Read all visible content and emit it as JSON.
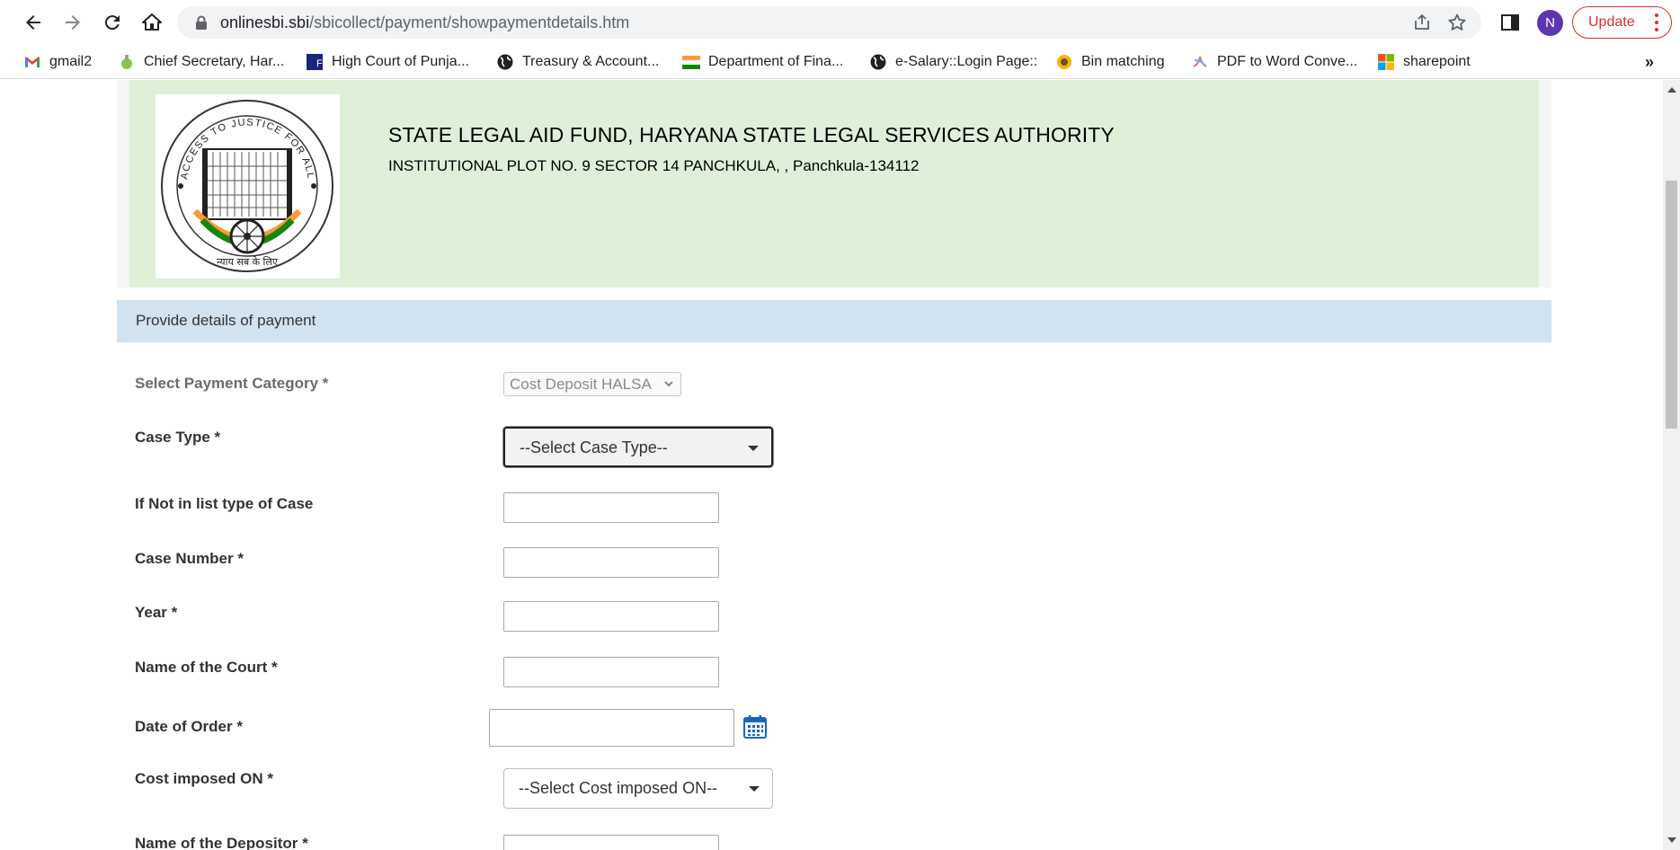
{
  "browser": {
    "url_host": "onlinesbi.sbi",
    "url_path": "/sbicollect/payment/showpaymentdetails.htm",
    "profile_initial": "N",
    "update_label": "Update",
    "bookmarks": [
      {
        "label": "gmail2",
        "icon": "gmail-icon"
      },
      {
        "label": "Chief Secretary, Har...",
        "icon": "emblem-icon"
      },
      {
        "label": "High Court of Punja...",
        "icon": "hc-icon"
      },
      {
        "label": "Treasury & Account...",
        "icon": "globe-icon"
      },
      {
        "label": "Department of Fina...",
        "icon": "flag-icon"
      },
      {
        "label": "e-Salary::Login Page::",
        "icon": "globe-icon"
      },
      {
        "label": "Bin matching",
        "icon": "bin-icon"
      },
      {
        "label": "PDF to Word Conve...",
        "icon": "pdf-icon"
      },
      {
        "label": "sharepoint",
        "icon": "ms-icon"
      }
    ],
    "more_label": "»"
  },
  "header": {
    "title": "STATE LEGAL AID FUND, HARYANA STATE LEGAL SERVICES AUTHORITY",
    "address": "INSTITUTIONAL PLOT NO. 9 SECTOR 14 PANCHKULA, , Panchkula-134112",
    "logo_text_top": "ACCESS TO JUSTICE FOR ALL",
    "logo_text_bottom": "न्याय सब के लिए"
  },
  "form": {
    "section_title": "Provide details of payment",
    "payment_category_label": "Select Payment Category *",
    "payment_category_value": "Cost Deposit HALSA",
    "case_type_label": "Case Type *",
    "case_type_value": "--Select Case Type--",
    "case_other_label": "If Not in list type of Case",
    "case_number_label": "Case Number *",
    "year_label": "Year *",
    "court_label": "Name of the Court *",
    "date_order_label": "Date of Order *",
    "cost_imposed_label": "Cost imposed ON *",
    "cost_imposed_value": "--Select Cost imposed ON--",
    "depositor_label": "Name of the Depositor *"
  },
  "colors": {
    "header_bg": "#dff0d8",
    "section_bg": "#d1e2f0",
    "update_accent": "#d93025",
    "avatar_bg": "#5e35b1"
  }
}
